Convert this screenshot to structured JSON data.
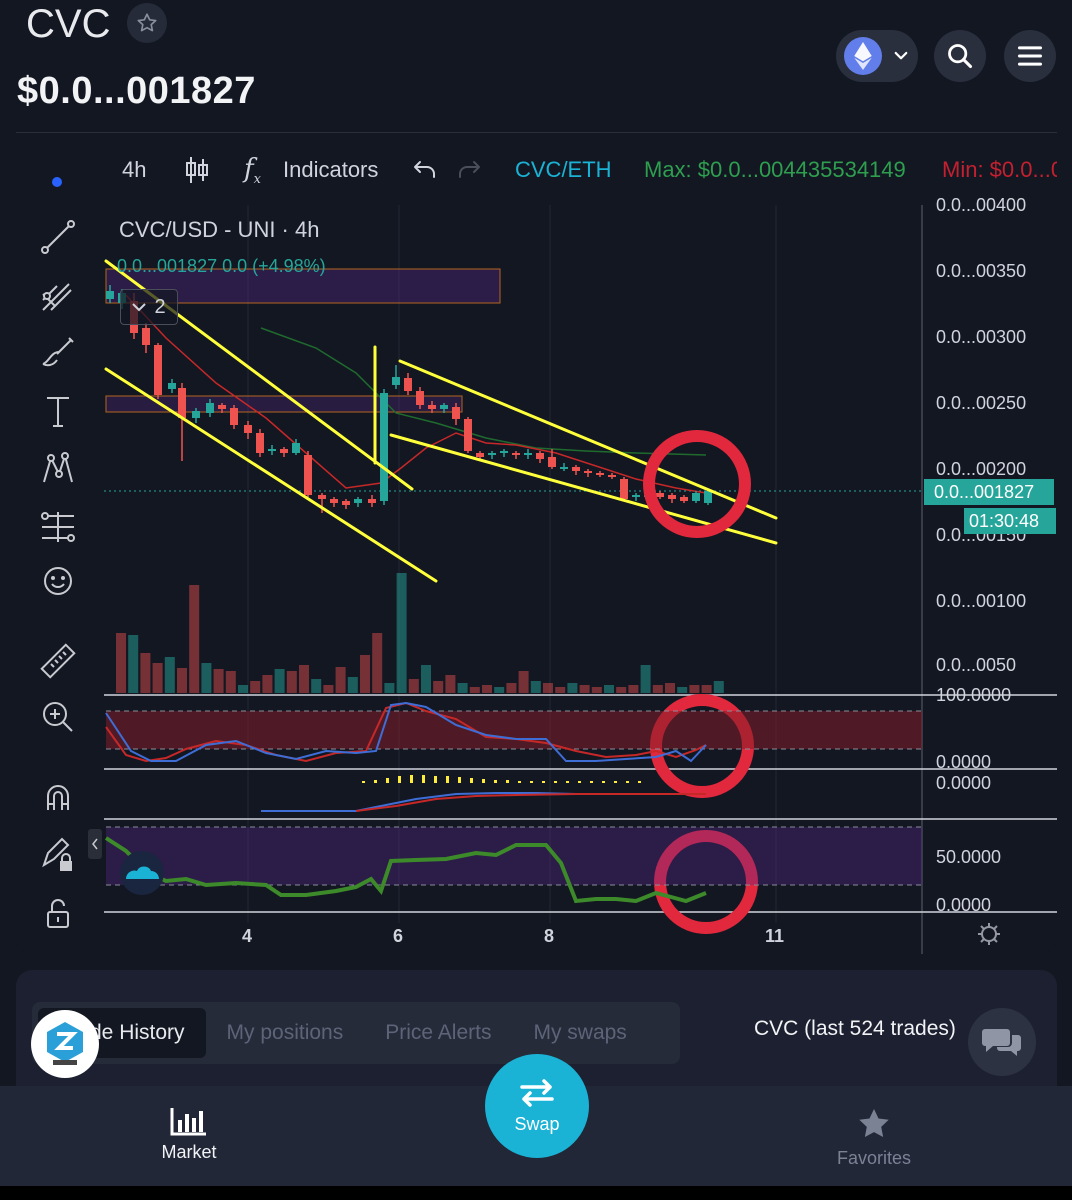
{
  "header": {
    "token": "CVC",
    "price": "$0.0...001827"
  },
  "toolbar": {
    "interval": "4h",
    "indicators": "Indicators",
    "pair": "CVC/ETH",
    "max": "Max: $0.0...004435534149",
    "min": "Min: $0.0...0"
  },
  "chart": {
    "symbol_line": "CVC/USD - UNI · 4h",
    "ohlc_line": "0.0...001827  0.0 (+4.98%)",
    "collapse_count": "2",
    "price_ticks": [
      "0.0...00400",
      "0.0...00350",
      "0.0...00300",
      "0.0...00250",
      "0.0...00200",
      "0.0...00150",
      "0.0...00100",
      "0.0...0050"
    ],
    "current_price_label": "0.0...001827",
    "countdown": "01:30:48",
    "osc1_ticks": [
      "100.0000",
      "0.0000"
    ],
    "osc2_ticks": [
      "0.0000"
    ],
    "osc3_ticks": [
      "50.0000",
      "0.0000"
    ],
    "x_ticks": [
      "4",
      "6",
      "8",
      "11"
    ],
    "colors": {
      "up": "#26a69a",
      "down": "#ef5350",
      "trendline": "#ffff3b",
      "highlight": "#e2283c",
      "accent": "#1ab3d6"
    }
  },
  "trades": {
    "tabs": [
      "Trade History",
      "My positions",
      "Price Alerts",
      "My swaps"
    ],
    "active_tab_visible": "de History",
    "title": "CVC (last 524 trades)"
  },
  "nav": {
    "market": "Market",
    "swap": "Swap",
    "favorites": "Favorites"
  }
}
